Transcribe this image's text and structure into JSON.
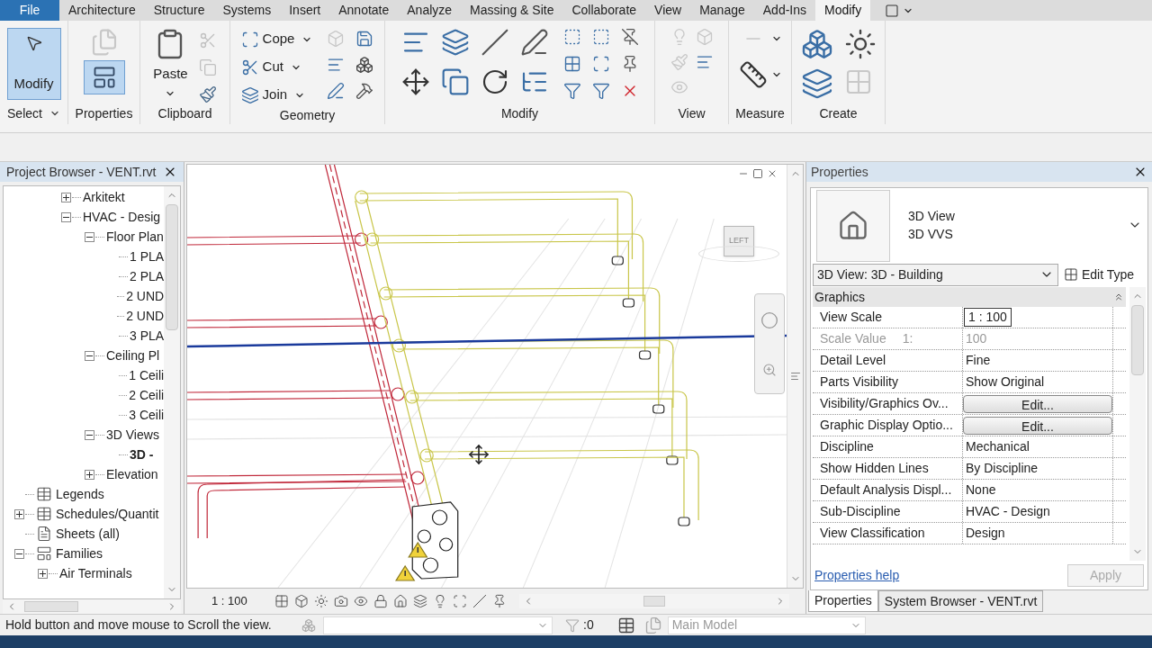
{
  "menu_tabs": [
    {
      "label": "File",
      "kind": "application",
      "selected": false
    },
    {
      "label": "Architecture",
      "kind": "tab",
      "selected": false
    },
    {
      "label": "Structure",
      "kind": "tab",
      "selected": false
    },
    {
      "label": "Systems",
      "kind": "tab",
      "selected": false
    },
    {
      "label": "Insert",
      "kind": "tab",
      "selected": false
    },
    {
      "label": "Annotate",
      "kind": "tab",
      "selected": false
    },
    {
      "label": "Analyze",
      "kind": "tab",
      "selected": false
    },
    {
      "label": "Massing & Site",
      "kind": "tab",
      "selected": false
    },
    {
      "label": "Collaborate",
      "kind": "tab",
      "selected": false
    },
    {
      "label": "View",
      "kind": "tab",
      "selected": false
    },
    {
      "label": "Manage",
      "kind": "tab",
      "selected": false
    },
    {
      "label": "Add-Ins",
      "kind": "tab",
      "selected": false
    },
    {
      "label": "Modify",
      "kind": "tab",
      "selected": true
    }
  ],
  "ribbon": {
    "modify_button": {
      "label": "Modify",
      "selected": true
    },
    "paste_button": {
      "label": "Paste"
    },
    "geometry_tools": [
      {
        "label": "Cope"
      },
      {
        "label": "Cut"
      },
      {
        "label": "Join"
      }
    ],
    "panels": [
      "Select",
      "Properties",
      "Clipboard",
      "Geometry",
      "Modify",
      "View",
      "Measure",
      "Create"
    ]
  },
  "project_browser": {
    "title": "Project Browser - VENT.rvt",
    "tree": [
      {
        "children": [
          {
            "children": [
              {
                "label": "Arkitekt",
                "expanded": false
              },
              {
                "label": "HVAC - Desig",
                "expanded": true,
                "children": [
                  {
                    "label": "Floor Plan",
                    "expanded": true,
                    "children": [
                      {
                        "label": "1 PLA"
                      },
                      {
                        "label": "2 PLA"
                      },
                      {
                        "label": "2 UND"
                      },
                      {
                        "label": "2 UND"
                      },
                      {
                        "label": "3 PLA"
                      }
                    ]
                  },
                  {
                    "label": "Ceiling Pl",
                    "expanded": true,
                    "children": [
                      {
                        "label": "1 Ceili"
                      },
                      {
                        "label": "2 Ceili"
                      },
                      {
                        "label": "3 Ceili"
                      }
                    ]
                  },
                  {
                    "label": "3D Views",
                    "expanded": true,
                    "children": [
                      {
                        "label": "3D -",
                        "selected": true
                      }
                    ]
                  },
                  {
                    "label": "Elevation",
                    "expanded": false
                  }
                ]
              }
            ]
          }
        ]
      },
      {
        "label": "Legends",
        "kind": "legends"
      },
      {
        "label": "Schedules/Quantit",
        "kind": "schedules",
        "expanded": false
      },
      {
        "label": "Sheets (all)",
        "kind": "sheets"
      },
      {
        "label": "Families",
        "kind": "families",
        "expanded": true,
        "children": [
          {
            "label": "Air Terminals",
            "expanded": false
          }
        ]
      }
    ]
  },
  "viewport": {
    "view_cube": {
      "face": "LEFT"
    },
    "scale": "1 : 100"
  },
  "properties": {
    "title": "Properties",
    "type_name": "3D View",
    "type_sub": "3D VVS",
    "instance_selector": "3D View: 3D - Building",
    "edit_type": "Edit Type",
    "section": {
      "label": "Graphics",
      "expanded": true
    },
    "rows": [
      {
        "label": "View Scale",
        "value": "1 : 100",
        "kind": "field"
      },
      {
        "label": "Scale Value",
        "suffix": "1:",
        "value": "100",
        "kind": "readonly"
      },
      {
        "label": "Detail Level",
        "value": "Fine",
        "kind": "text"
      },
      {
        "label": "Parts Visibility",
        "value": "Show Original",
        "kind": "text"
      },
      {
        "label": "Visibility/Graphics Ov...",
        "value": "Edit...",
        "kind": "button"
      },
      {
        "label": "Graphic Display Optio...",
        "value": "Edit...",
        "kind": "button"
      },
      {
        "label": "Discipline",
        "value": "Mechanical",
        "kind": "text"
      },
      {
        "label": "Show Hidden Lines",
        "value": "By Discipline",
        "kind": "text"
      },
      {
        "label": "Default Analysis Displ...",
        "value": "None",
        "kind": "text"
      },
      {
        "label": "Sub-Discipline",
        "value": "HVAC - Design",
        "kind": "text"
      },
      {
        "label": "View Classification",
        "value": "Design",
        "kind": "text"
      }
    ],
    "help_link": "Properties help",
    "apply": {
      "label": "Apply",
      "disabled": true
    },
    "tabs": [
      {
        "label": "Properties",
        "selected": true
      },
      {
        "label": "System Browser - VENT.rvt",
        "selected": false
      }
    ]
  },
  "status_bar": {
    "message": "Hold button and move mouse to Scroll the view.",
    "count": ":0",
    "model": {
      "value": "Main Model",
      "disabled": true
    }
  }
}
